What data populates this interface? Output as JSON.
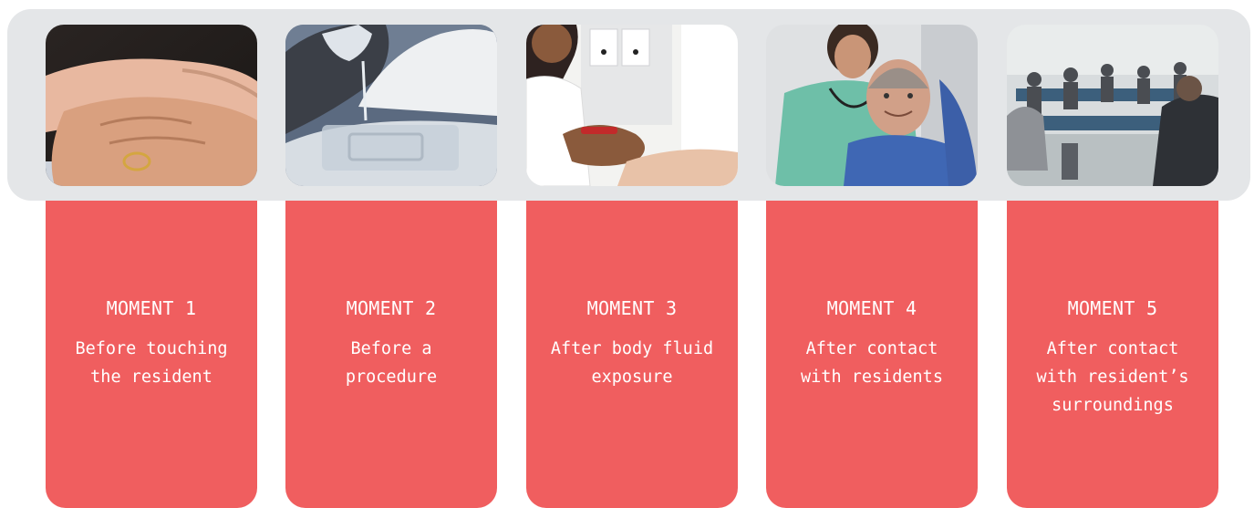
{
  "colors": {
    "band": "#e4e6e8",
    "panel": "#f05e5f",
    "text": "#ffffff"
  },
  "moments": [
    {
      "title": "MOMENT 1",
      "lines": [
        "Before touching",
        "the resident"
      ],
      "image": "hands-holding-photo"
    },
    {
      "title": "MOMENT 2",
      "lines": [
        "Before a",
        "procedure"
      ],
      "image": "medical-procedure-photo"
    },
    {
      "title": "MOMENT 3",
      "lines": [
        "After body fluid",
        "exposure"
      ],
      "image": "blood-test-photo"
    },
    {
      "title": "MOMENT 4",
      "lines": [
        "After contact",
        "with residents"
      ],
      "image": "nurse-with-resident-photo"
    },
    {
      "title": "MOMENT 5",
      "lines": [
        "After contact",
        "with resident’s",
        "surroundings"
      ],
      "image": "waiting-room-photo"
    }
  ]
}
